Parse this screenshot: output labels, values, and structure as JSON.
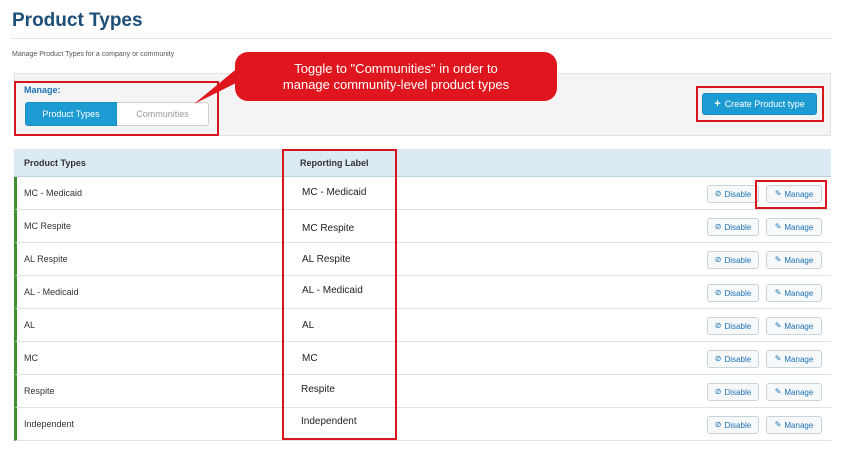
{
  "page": {
    "title": "Product Types",
    "subtitle": "Manage Product Types for a company or community"
  },
  "manage": {
    "label": "Manage:",
    "options": [
      "Product Types",
      "Communities"
    ],
    "selected": "Product Types"
  },
  "create_button": {
    "icon": "plus-icon",
    "label": "Create Product type"
  },
  "callout": {
    "lines": [
      "Toggle to \"Communities\" in order to",
      "manage community-level product types"
    ]
  },
  "table": {
    "columns": [
      "Product Types",
      "Reporting Label"
    ],
    "rows": [
      {
        "type": "MC - Medicaid",
        "label": "MC - Medicaid"
      },
      {
        "type": "MC Respite",
        "label": "MC Respite"
      },
      {
        "type": "AL Respite",
        "label": "AL Respite"
      },
      {
        "type": "AL - Medicaid",
        "label": "AL - Medicaid"
      },
      {
        "type": "AL",
        "label": "AL"
      },
      {
        "type": "MC",
        "label": "MC"
      },
      {
        "type": "Respite",
        "label": "Respite"
      },
      {
        "type": "Independent",
        "label": "Independent"
      }
    ],
    "actions": {
      "disable_label": "Disable",
      "disable_icon": "ban-icon",
      "manage_label": "Manage",
      "manage_icon": "edit-icon"
    }
  },
  "colors": {
    "title": "#1e4f7a",
    "accent": "#1d9cd3",
    "annotation": "#d7151c",
    "row_marker": "#3f8f2f",
    "header_bg": "#dcebf3"
  }
}
